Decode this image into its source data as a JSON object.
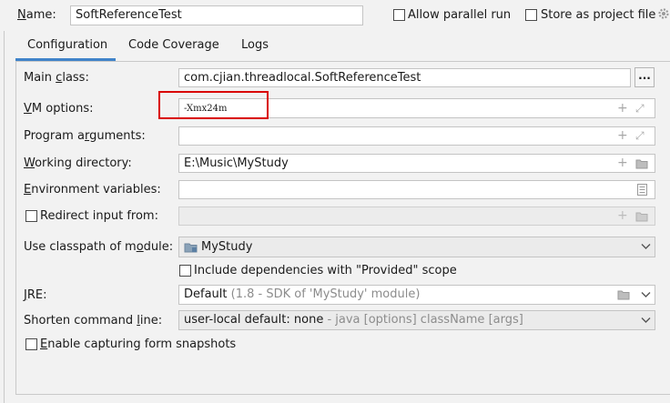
{
  "header": {
    "name_label": "Name:",
    "name_value": "SoftReferenceTest",
    "allow_parallel_run": "Allow parallel run",
    "store_as_project_file": "Store as project file"
  },
  "tabs": [
    "Configuration",
    "Code Coverage",
    "Logs"
  ],
  "form": {
    "main_class_label": "Main class:",
    "main_class_value": "com.cjian.threadlocal.SoftReferenceTest",
    "browse_button": "...",
    "vm_options_label": "VM options:",
    "vm_options_value": "-Xmx24m",
    "program_arguments_label": "Program arguments:",
    "program_arguments_value": "",
    "working_directory_label": "Working directory:",
    "working_directory_value": "E:\\Music\\MyStudy",
    "environment_variables_label": "Environment variables:",
    "environment_variables_value": "",
    "redirect_input_label": "Redirect input from:",
    "classpath_label": "Use classpath of module:",
    "classpath_value": "MyStudy",
    "include_dependencies_label": "Include dependencies with \"Provided\" scope",
    "jre_label": "JRE:",
    "jre_value_main": "Default",
    "jre_value_hint": " (1.8 - SDK of 'MyStudy' module)",
    "shorten_label": "Shorten command line:",
    "shorten_value_main": "user-local default: none",
    "shorten_value_hint": " - java [options] className [args]",
    "enable_capturing_label": "Enable capturing form snapshots"
  },
  "colors": {
    "accent_tab_underline": "#4083c9",
    "highlight_box": "#d90000",
    "hint_text": "#8c8c8c"
  },
  "icons": [
    "plus-icon",
    "expand-icon",
    "folder-icon",
    "document-icon",
    "chevron-down-icon",
    "module-icon",
    "gear-icon"
  ]
}
